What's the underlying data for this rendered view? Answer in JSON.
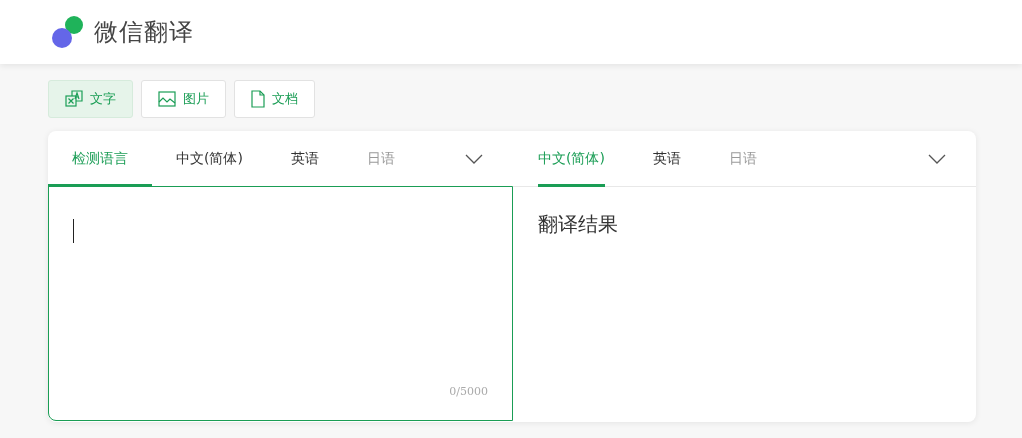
{
  "header": {
    "title": "微信翻译"
  },
  "modes": [
    {
      "kind": "text",
      "label": "文字",
      "selected": true
    },
    {
      "kind": "image",
      "label": "图片",
      "selected": false
    },
    {
      "kind": "document",
      "label": "文档",
      "selected": false
    }
  ],
  "source_tabs": [
    {
      "label": "检测语言",
      "selected": true,
      "faded": false
    },
    {
      "label": "中文(简体)",
      "selected": false,
      "faded": false
    },
    {
      "label": "英语",
      "selected": false,
      "faded": false
    },
    {
      "label": "日语",
      "selected": false,
      "faded": true
    }
  ],
  "target_tabs": [
    {
      "label": "中文(简体)",
      "selected": true,
      "faded": false
    },
    {
      "label": "英语",
      "selected": false,
      "faded": false
    },
    {
      "label": "日语",
      "selected": false,
      "faded": true
    }
  ],
  "input": {
    "counter": "0/5000"
  },
  "output": {
    "placeholder_text": "翻译结果"
  }
}
